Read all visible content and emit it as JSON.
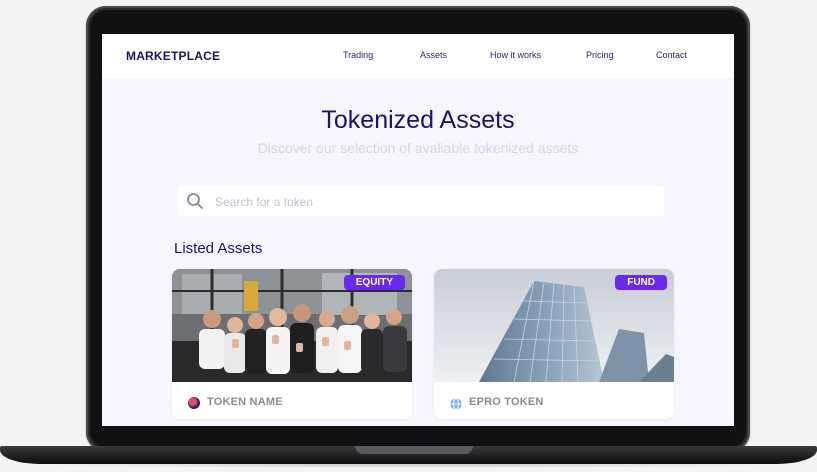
{
  "nav": {
    "brand": "MARKETPLACE",
    "links": [
      "Trading",
      "Assets",
      "How it works",
      "Pricing",
      "Contact"
    ]
  },
  "hero": {
    "title": "Tokenized Assets",
    "subtitle": "Discover our selection of avaliable tokenized assets"
  },
  "search": {
    "placeholder": "Search for a token",
    "value": "",
    "icon": "search-icon"
  },
  "listed": {
    "title": "Listed Assets",
    "cards": [
      {
        "badge": "EQUITY",
        "name": "TOKEN NAME",
        "image": "team-photo",
        "icon": "token-dot-icon"
      },
      {
        "badge": "FUND",
        "name": "EPRO TOKEN",
        "image": "office-building-photo",
        "icon": "globe-icon"
      }
    ]
  },
  "colors": {
    "brand": "#1f1266",
    "accent": "#6d28f0",
    "background": "#f7f5ff"
  }
}
